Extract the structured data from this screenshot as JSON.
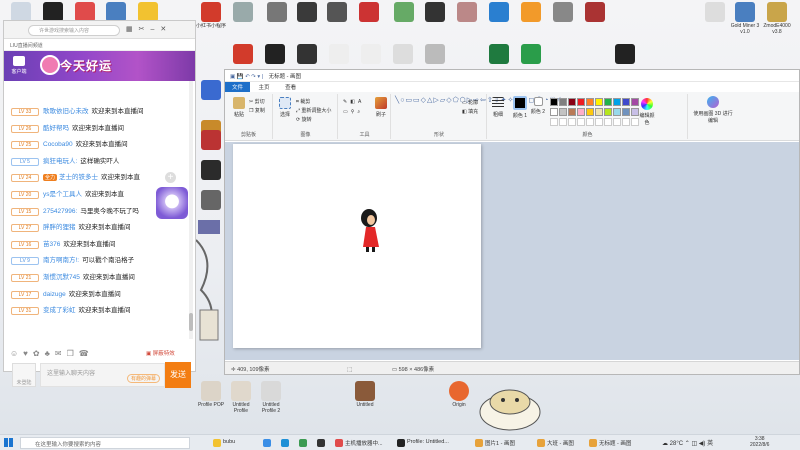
{
  "desktop": {
    "top_icons": [
      "",
      "",
      "",
      "",
      "",
      "小红书小程序",
      "",
      "",
      "",
      "",
      "",
      "",
      "",
      "",
      "",
      "",
      "",
      ""
    ],
    "right_icons": [
      "",
      "Gold Miner 3 v1.0",
      "ZmodE4000 v3.8"
    ],
    "row2_icons": [
      "",
      "",
      "",
      "",
      "",
      "",
      "",
      "",
      "",
      ""
    ],
    "bottom_icons": [
      {
        "label": "Profile POP"
      },
      {
        "label": "Untitled Profile"
      },
      {
        "label": "Untitled Profile 2"
      },
      {
        "label": "Untitled"
      },
      {
        "label": "Origin"
      }
    ]
  },
  "chat": {
    "search_placeholder": "许世游戏搜索输入内容",
    "url": "LIU直播间频道",
    "kefu": "客户端",
    "title": "今天好运",
    "messages": [
      {
        "level": "LV 33",
        "medal": "",
        "user": "歌歌依旧心未改",
        "text": "欢迎来到本直播间"
      },
      {
        "level": "LV 26",
        "medal": "",
        "user": "酷好帮吗",
        "text": "欢迎来到本直播间"
      },
      {
        "level": "LV 25",
        "medal": "",
        "user": "Cocoba90",
        "text": "欢迎来到本直播间"
      },
      {
        "level": "LV 5",
        "medal": "",
        "user": "疯狂电玩人:",
        "text": "这样确实吓人"
      },
      {
        "level": "LV 24",
        "medal": "全力",
        "user": "芝士的铁多士",
        "text": "欢迎来到本直"
      },
      {
        "level": "LV 20",
        "medal": "",
        "user": "ys是个工具人",
        "text": "欢迎来到本直"
      },
      {
        "level": "LV 15",
        "medal": "",
        "user": "275427996:",
        "text": "马里奥今晚不玩了吗"
      },
      {
        "level": "LV 27",
        "medal": "",
        "user": "胖胖的狸猪",
        "text": "欢迎来到本直播间"
      },
      {
        "level": "LV 16",
        "medal": "",
        "user": "苗376",
        "text": "欢迎来到本直播间"
      },
      {
        "level": "LV 9",
        "medal": "",
        "user": "南方啊南方!:",
        "text": "可以戳个南沿格子"
      },
      {
        "level": "LV 21",
        "medal": "",
        "user": "渐惯沉默745",
        "text": "欢迎来到本直播间"
      },
      {
        "level": "LV 17",
        "medal": "",
        "user": "daizuge",
        "text": "欢迎来到本直播间"
      },
      {
        "level": "LV 31",
        "medal": "",
        "user": "变成了彩虹",
        "text": "欢迎来到本直播间"
      }
    ],
    "report": "屏蔽特效",
    "input_placeholder": "这里输入聊天内容",
    "avatar_label": "未登陆",
    "danmu": "有趣的弹幕",
    "send": "发送"
  },
  "paint": {
    "title": "无标题 - 画图",
    "tabs": [
      "文件",
      "主页",
      "查看"
    ],
    "groups": {
      "clipboard": "剪贴板",
      "image": "图像",
      "tools": "工具",
      "shapes": "形状",
      "colors": "颜色"
    },
    "buttons": {
      "paste": "粘贴",
      "cut": "剪切",
      "copy": "复制",
      "select": "选择",
      "crop": "裁剪",
      "resize": "重新调整大小",
      "rotate": "旋转",
      "brush": "刷子",
      "outline": "轮廓",
      "fill": "填充",
      "size": "粗细",
      "color1": "颜色 1",
      "color2": "颜色 2",
      "edit_colors": "编辑颜色",
      "paint3d": "使用画图 3D 进行编辑"
    },
    "palette": [
      "#000000",
      "#7f7f7f",
      "#880015",
      "#ed1c24",
      "#ff7f27",
      "#fff200",
      "#22b14c",
      "#00a2e8",
      "#3f48cc",
      "#a349a4",
      "#ffffff",
      "#c3c3c3",
      "#b97a57",
      "#ffaec9",
      "#ffc90e",
      "#efe4b0",
      "#b5e61d",
      "#99d9ea",
      "#7092be",
      "#c8bfe7"
    ],
    "status": {
      "cursor": "409, 109像素",
      "canvas_size": "598 × 486像素"
    }
  },
  "taskbar": {
    "search": "在这里输入你要搜索的内容",
    "items": [
      {
        "label": "bubu",
        "color": "#f2c230",
        "open": false
      },
      {
        "label": "",
        "color": "#3a8ee6",
        "open": false
      },
      {
        "label": "",
        "color": "#1e90d6",
        "open": false
      },
      {
        "label": "",
        "color": "#3c9b52",
        "open": false
      },
      {
        "label": "",
        "color": "#333333",
        "open": false
      },
      {
        "label": "主机播放器中...",
        "color": "#e04b4b",
        "open": true
      },
      {
        "label": "Profile: Untitled...",
        "color": "#222222",
        "open": true
      },
      {
        "label": "图片1 - 画图",
        "color": "#e7a23a",
        "open": true
      },
      {
        "label": "大班 - 画图",
        "color": "#e7a23a",
        "open": true
      },
      {
        "label": "无标题 - 画图",
        "color": "#e7a23a",
        "open": true
      }
    ],
    "weather": "28°C",
    "ime": "英",
    "time": "3:38",
    "date": "2022/8/6"
  },
  "colors": {
    "accent": "#1e6fc9",
    "send": "#f37d12",
    "banner": "#9147c9",
    "figure_dress": "#e32828"
  }
}
